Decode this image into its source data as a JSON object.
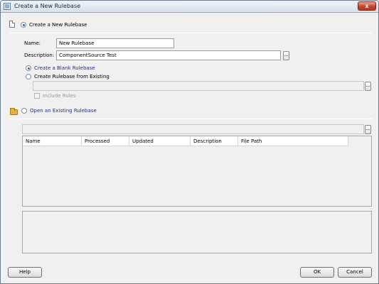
{
  "window": {
    "title": "Create a New Rulebase",
    "close_glyph": "x"
  },
  "create_new": {
    "label": "Create a New Rulebase",
    "selected": true,
    "icon": "new-document-icon",
    "name_label": "Name:",
    "name_value": "New Rulebase",
    "description_label": "Description:",
    "description_value": "ComponentSource Test",
    "browse_glyph": "...",
    "blank_label": "Create a Blank Rulebase",
    "blank_selected": true,
    "from_existing_label": "Create Rulebase from Existing",
    "from_existing_selected": false,
    "existing_path_value": "",
    "include_rules_label": "Include Rules",
    "include_rules_checked": false
  },
  "open_existing": {
    "label": "Open an Existing Rulebase",
    "selected": false,
    "icon": "open-folder-icon",
    "path_value": "",
    "browse_glyph": "...",
    "columns": [
      "Name",
      "Processed",
      "Updated",
      "Description",
      "File Path"
    ],
    "rows": []
  },
  "footer": {
    "help_label": "Help",
    "ok_label": "OK",
    "cancel_label": "Cancel"
  }
}
